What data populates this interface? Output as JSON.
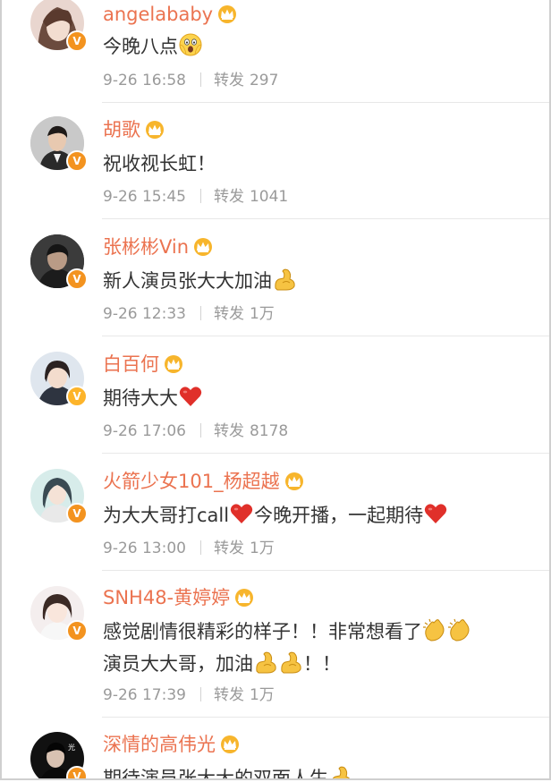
{
  "colors": {
    "name": "#eb7350",
    "text": "#333333",
    "meta": "#9a9a9a",
    "badge_orange": "#f3931f",
    "badge_yellow": "#fdb42a"
  },
  "badge_label": "V",
  "repost_label": "转发",
  "comments": [
    {
      "name": "angelababy",
      "text": "今晚八点",
      "emojis": [
        "scream-emoji"
      ],
      "date": "9-26 16:58",
      "reposts": "297",
      "badge": "orange"
    },
    {
      "name": "胡歌",
      "text": "祝收视长虹！",
      "emojis": [],
      "date": "9-26 15:45",
      "reposts": "1041",
      "badge": "orange"
    },
    {
      "name": "张彬彬Vin",
      "text": "新人演员张大大加油",
      "emojis": [
        "flexed-biceps-emoji"
      ],
      "date": "9-26 12:33",
      "reposts": "1万",
      "badge": "orange"
    },
    {
      "name": "白百何",
      "text": "期待大大",
      "emojis": [
        "red-heart-emoji"
      ],
      "date": "9-26 17:06",
      "reposts": "8178",
      "badge": "yellow"
    },
    {
      "name": "火箭少女101_杨超越",
      "text_parts": [
        "为大大哥打call",
        "今晚开播，一起期待"
      ],
      "emojis": [
        "red-heart-emoji",
        "red-heart-emoji"
      ],
      "date": "9-26 13:00",
      "reposts": "1万",
      "badge": "orange"
    },
    {
      "name": "SNH48-黄婷婷",
      "text": "感觉剧情很精彩的样子！！非常想看了",
      "text_line2_parts": [
        "演员大大哥，加油",
        "！！"
      ],
      "emojis": [
        "clapping-hands-emoji",
        "clapping-hands-emoji",
        "flexed-biceps-emoji",
        "flexed-biceps-emoji"
      ],
      "date": "9-26 17:39",
      "reposts": "1万",
      "badge": "orange"
    },
    {
      "name": "深情的高伟光",
      "text": "期待演员张大大的双面人生",
      "emojis": [
        "flexed-biceps-emoji"
      ],
      "badge": "orange"
    }
  ]
}
